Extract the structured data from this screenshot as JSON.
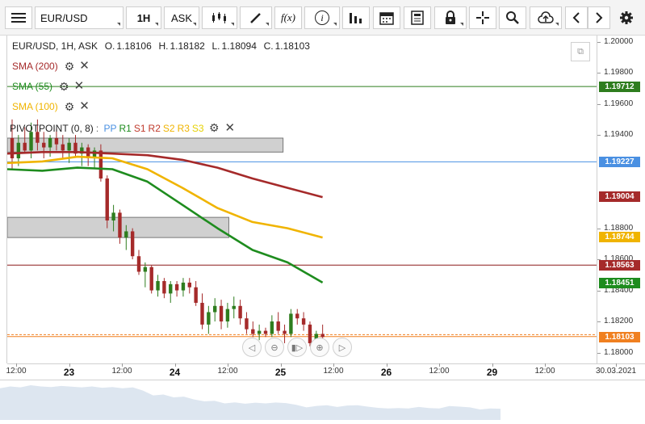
{
  "toolbar": {
    "symbol": "EUR/USD",
    "timeframe": "1H",
    "price_type": "ASK",
    "icons": [
      "menu-icon",
      "candle-type-icon",
      "draw-icon",
      "function-icon",
      "info-icon",
      "volume-bars-icon",
      "calendar-icon",
      "report-icon",
      "lock-icon",
      "crosshair-icon",
      "search-zoom-icon",
      "cloud-upload-icon",
      "chevron-left-icon",
      "chevron-right-icon",
      "gear-icon"
    ],
    "function_label": "f(x)",
    "info_label": "i"
  },
  "header": {
    "instrument": "EUR/USD, 1H, ASK",
    "open_label": "O.",
    "open": "1.18106",
    "high_label": "H.",
    "high": "1.18182",
    "low_label": "L.",
    "low": "1.18094",
    "close_label": "C.",
    "close": "1.18103"
  },
  "indicators": [
    {
      "label": "SMA (200)",
      "color": "#a52a2a"
    },
    {
      "label": "SMA (55)",
      "color": "#1e8c1e"
    },
    {
      "label": "SMA (100)",
      "color": "#f0b400"
    }
  ],
  "pivot": {
    "label": "PIVOTPOINT (0, 8)",
    "sep": ":",
    "levels": [
      {
        "label": "PP",
        "color": "#4a90e2"
      },
      {
        "label": "R1",
        "color": "#1e8c1e"
      },
      {
        "label": "S1",
        "color": "#c0392b"
      },
      {
        "label": "R2",
        "color": "#c0392b"
      },
      {
        "label": "S2",
        "color": "#f0b400"
      },
      {
        "label": "R3",
        "color": "#f0b400"
      },
      {
        "label": "S3",
        "color": "#e6d200"
      }
    ]
  },
  "price_axis": {
    "ticks": [
      "1.20000",
      "1.19800",
      "1.19600",
      "1.19400",
      "1.18800",
      "1.18600",
      "1.18400",
      "1.18200",
      "1.18000"
    ],
    "tags": [
      {
        "value": "1.19712",
        "color": "#2e7d1e"
      },
      {
        "value": "1.19227",
        "color": "#4a90e2"
      },
      {
        "value": "1.19004",
        "color": "#a52a2a"
      },
      {
        "value": "1.18744",
        "color": "#f0b400"
      },
      {
        "value": "1.18563",
        "color": "#a52a2a"
      },
      {
        "value": "1.18451",
        "color": "#1e8c1e"
      },
      {
        "value": "1.18103",
        "color": "#f08020"
      }
    ]
  },
  "time_axis": {
    "labels": [
      {
        "text": "12:00",
        "day": false
      },
      {
        "text": "23",
        "day": true
      },
      {
        "text": "12:00",
        "day": false
      },
      {
        "text": "24",
        "day": true
      },
      {
        "text": "12:00",
        "day": false
      },
      {
        "text": "25",
        "day": true
      },
      {
        "text": "12:00",
        "day": false
      },
      {
        "text": "26",
        "day": true
      },
      {
        "text": "12:00",
        "day": false
      },
      {
        "text": "29",
        "day": true
      },
      {
        "text": "12:00",
        "day": false
      },
      {
        "text": "30.03.2021",
        "day": false
      }
    ]
  },
  "zoom_controls": [
    "scroll-left-icon",
    "zoom-out-icon",
    "reset-zoom-icon",
    "zoom-in-icon",
    "scroll-right-icon"
  ],
  "chart_data": {
    "type": "line",
    "ylim": [
      1.1793,
      1.2004
    ],
    "candle_up_color": "#2e7d1e",
    "candle_down_color": "#a52a2a",
    "candles": [
      [
        1.1938,
        1.195,
        1.1918,
        1.1925
      ],
      [
        1.1925,
        1.194,
        1.192,
        1.1935
      ],
      [
        1.1935,
        1.1945,
        1.1928,
        1.193
      ],
      [
        1.193,
        1.1948,
        1.1925,
        1.1942
      ],
      [
        1.1942,
        1.195,
        1.193,
        1.1935
      ],
      [
        1.1935,
        1.1942,
        1.1925,
        1.1932
      ],
      [
        1.1932,
        1.194,
        1.1926,
        1.1938
      ],
      [
        1.1938,
        1.1944,
        1.193,
        1.1934
      ],
      [
        1.1934,
        1.194,
        1.1925,
        1.193
      ],
      [
        1.193,
        1.1938,
        1.1922,
        1.1935
      ],
      [
        1.1935,
        1.194,
        1.1926,
        1.1928
      ],
      [
        1.1928,
        1.1935,
        1.192,
        1.1932
      ],
      [
        1.1932,
        1.1934,
        1.192,
        1.1925
      ],
      [
        1.1925,
        1.1932,
        1.1918,
        1.193
      ],
      [
        1.193,
        1.1934,
        1.191,
        1.1912
      ],
      [
        1.1912,
        1.1914,
        1.188,
        1.1885
      ],
      [
        1.1885,
        1.1895,
        1.1878,
        1.189
      ],
      [
        1.189,
        1.1892,
        1.187,
        1.1874
      ],
      [
        1.1874,
        1.1882,
        1.1866,
        1.1878
      ],
      [
        1.1878,
        1.188,
        1.186,
        1.1862
      ],
      [
        1.1862,
        1.1866,
        1.185,
        1.1852
      ],
      [
        1.1852,
        1.1858,
        1.1842,
        1.1855
      ],
      [
        1.1855,
        1.1856,
        1.1838,
        1.184
      ],
      [
        1.184,
        1.185,
        1.1836,
        1.1846
      ],
      [
        1.1846,
        1.1848,
        1.1835,
        1.1838
      ],
      [
        1.1838,
        1.1846,
        1.1832,
        1.1844
      ],
      [
        1.1844,
        1.1846,
        1.1836,
        1.184
      ],
      [
        1.184,
        1.1848,
        1.1836,
        1.1845
      ],
      [
        1.1845,
        1.1848,
        1.1838,
        1.1842
      ],
      [
        1.1842,
        1.1846,
        1.183,
        1.1832
      ],
      [
        1.1832,
        1.1838,
        1.1815,
        1.1818
      ],
      [
        1.1818,
        1.183,
        1.1812,
        1.1826
      ],
      [
        1.1826,
        1.1835,
        1.182,
        1.183
      ],
      [
        1.183,
        1.1834,
        1.1815,
        1.182
      ],
      [
        1.182,
        1.1832,
        1.1816,
        1.1828
      ],
      [
        1.1828,
        1.1836,
        1.1822,
        1.183
      ],
      [
        1.183,
        1.1834,
        1.1818,
        1.1822
      ],
      [
        1.1822,
        1.1826,
        1.1812,
        1.1815
      ],
      [
        1.1815,
        1.182,
        1.181,
        1.1812
      ],
      [
        1.1812,
        1.1818,
        1.1808,
        1.1814
      ],
      [
        1.1814,
        1.1816,
        1.181,
        1.1812
      ],
      [
        1.1812,
        1.1824,
        1.181,
        1.182
      ],
      [
        1.182,
        1.1826,
        1.1812,
        1.1814
      ],
      [
        1.1814,
        1.1818,
        1.1806,
        1.1812
      ],
      [
        1.1812,
        1.1828,
        1.181,
        1.1825
      ],
      [
        1.1825,
        1.1828,
        1.1818,
        1.1822
      ],
      [
        1.1822,
        1.1826,
        1.1814,
        1.1818
      ],
      [
        1.1818,
        1.182,
        1.1804,
        1.1806
      ],
      [
        1.1806,
        1.1814,
        1.1802,
        1.1812
      ],
      [
        1.1812,
        1.1818,
        1.1808,
        1.181
      ]
    ],
    "sma200": [
      1.1928,
      1.1929,
      1.1929,
      1.1928,
      1.1927,
      1.1924,
      1.1919,
      1.1912,
      1.1906,
      1.19
    ],
    "sma55": [
      1.1918,
      1.1917,
      1.1919,
      1.1918,
      1.191,
      1.1895,
      1.188,
      1.1866,
      1.1858,
      1.1845
    ],
    "sma100": [
      1.1922,
      1.1923,
      1.1926,
      1.1925,
      1.1918,
      1.1906,
      1.1893,
      1.1884,
      1.188,
      1.1874
    ],
    "hlines": [
      {
        "value": 1.19712,
        "color": "#2e7d1e"
      },
      {
        "value": 1.19227,
        "color": "#4a90e2"
      },
      {
        "value": 1.18563,
        "color": "#8b1a1a"
      },
      {
        "value": 1.18115,
        "color": "#f08020",
        "dash": true
      },
      {
        "value": 1.18103,
        "color": "#f08020"
      }
    ],
    "zones": [
      {
        "from": 1.1938,
        "to": 1.1929,
        "x0": 0.0,
        "x1": 0.468
      },
      {
        "from": 1.1887,
        "to": 1.1874,
        "x0": 0.0,
        "x1": 0.376
      }
    ]
  }
}
